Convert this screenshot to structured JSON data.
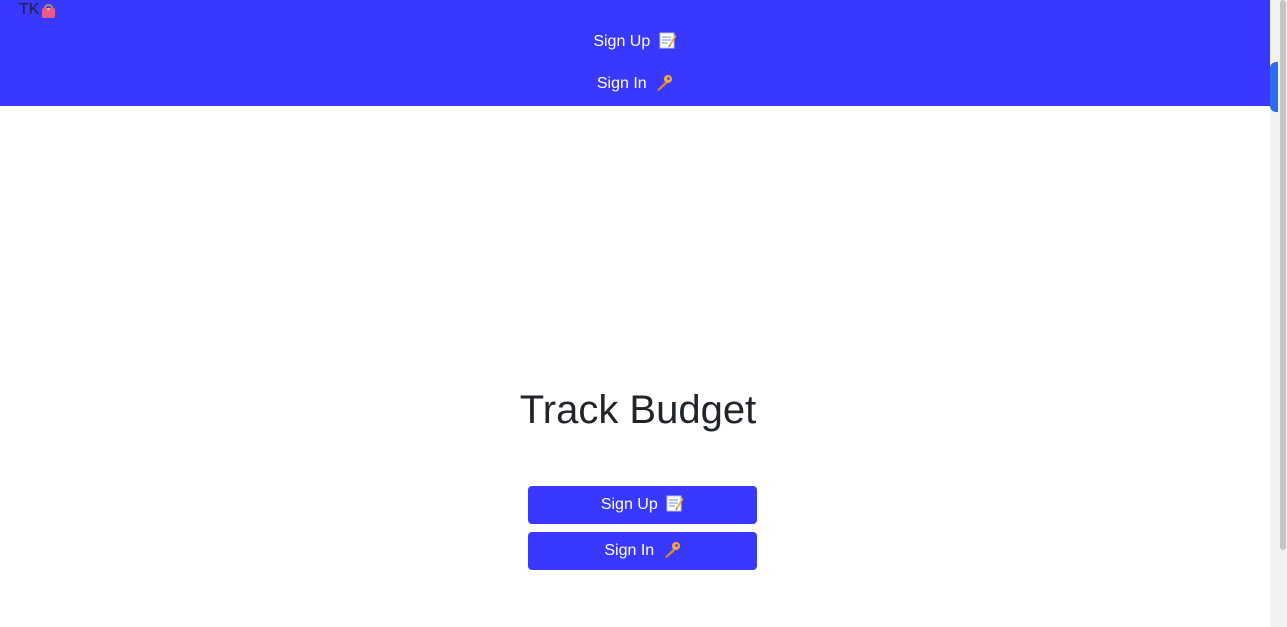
{
  "navbar": {
    "brand_text": "TK",
    "brand_icon": "purse-icon",
    "links": [
      {
        "label": "Sign Up",
        "icon": "memo-icon"
      },
      {
        "label": "Sign In",
        "icon": "key-icon"
      }
    ]
  },
  "hero": {
    "title": "Track Budget",
    "buttons": [
      {
        "label": "Sign Up",
        "icon": "memo-icon"
      },
      {
        "label": "Sign In",
        "icon": "key-icon"
      }
    ]
  },
  "colors": {
    "primary": "#3838ff",
    "button_text": "#ffffff",
    "title_text": "#212529"
  }
}
